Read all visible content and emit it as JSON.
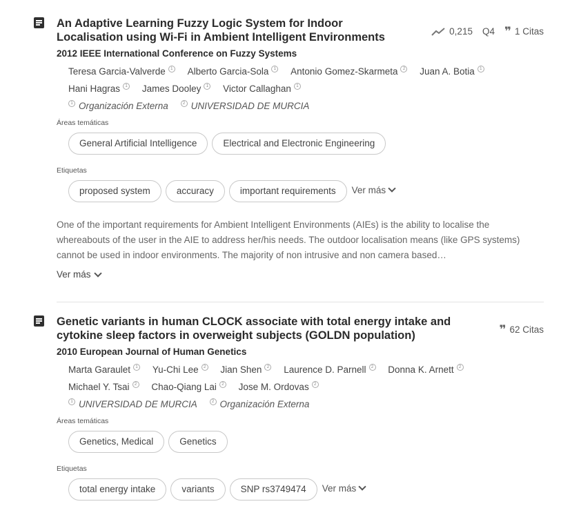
{
  "publications": [
    {
      "title": "An Adaptive Learning Fuzzy Logic System for Indoor Localisation using Wi-Fi in Ambient Intelligent Environments",
      "impact": "0,215",
      "quartile": "Q4",
      "citations": "1 Citas",
      "source": "2012 IEEE International Conference on Fuzzy Systems",
      "authors": [
        {
          "name": "Teresa Garcia-Valverde",
          "badge": "1"
        },
        {
          "name": "Alberto Garcia-Sola",
          "badge": "1"
        },
        {
          "name": "Antonio Gomez-Skarmeta",
          "badge": "2"
        },
        {
          "name": "Juan A. Botia",
          "badge": "1"
        },
        {
          "name": "Hani Hagras",
          "badge": "1"
        },
        {
          "name": "James Dooley",
          "badge": "1"
        },
        {
          "name": "Victor Callaghan",
          "badge": "1"
        }
      ],
      "orgs": [
        {
          "badge": "1",
          "name": "Organización Externa"
        },
        {
          "badge": "2",
          "name": "UNIVERSIDAD DE MURCIA"
        }
      ],
      "areas_label": "Áreas temáticas",
      "areas": [
        "General Artificial Intelligence",
        "Electrical and Electronic Engineering"
      ],
      "tags_label": "Etiquetas",
      "tags": [
        "proposed system",
        "accuracy",
        "important requirements"
      ],
      "tags_more": "Ver más",
      "abstract": "One of the important requirements for Ambient Intelligent Environments (AIEs) is the ability to localise the whereabouts of the user in the AIE to address her/his needs. The outdoor localisation means (like GPS systems) cannot be used in indoor environments. The majority of non intrusive and non camera based…",
      "abstract_more": "Ver más"
    },
    {
      "title": "Genetic variants in human CLOCK associate with total energy intake and cytokine sleep factors in overweight subjects (GOLDN population)",
      "citations": "62 Citas",
      "source": "2010 European Journal of Human Genetics",
      "authors": [
        {
          "name": "Marta Garaulet",
          "badge": "1"
        },
        {
          "name": "Yu-Chi Lee",
          "badge": "2"
        },
        {
          "name": "Jian Shen",
          "badge": "2"
        },
        {
          "name": "Laurence D. Parnell",
          "badge": "2"
        },
        {
          "name": "Donna K. Arnett",
          "badge": "2"
        },
        {
          "name": "Michael Y. Tsai",
          "badge": "2"
        },
        {
          "name": "Chao-Qiang Lai",
          "badge": "2"
        },
        {
          "name": "Jose M. Ordovas",
          "badge": "2"
        }
      ],
      "orgs": [
        {
          "badge": "1",
          "name": "UNIVERSIDAD DE MURCIA"
        },
        {
          "badge": "2",
          "name": "Organización Externa"
        }
      ],
      "areas_label": "Áreas temáticas",
      "areas": [
        "Genetics, Medical",
        "Genetics"
      ],
      "tags_label": "Etiquetas",
      "tags": [
        "total energy intake",
        "variants",
        "SNP rs3749474"
      ],
      "tags_more": "Ver más"
    }
  ],
  "colors": {
    "title": "#2b2b2b",
    "text": "#444444",
    "muted": "#666666",
    "chip_border": "#c8c8c8",
    "divider": "#e2e2e2"
  },
  "icons": {
    "publication": "article-icon",
    "impact": "trending-icon",
    "citations": "quote-icon",
    "expand": "chevron-down-icon"
  }
}
